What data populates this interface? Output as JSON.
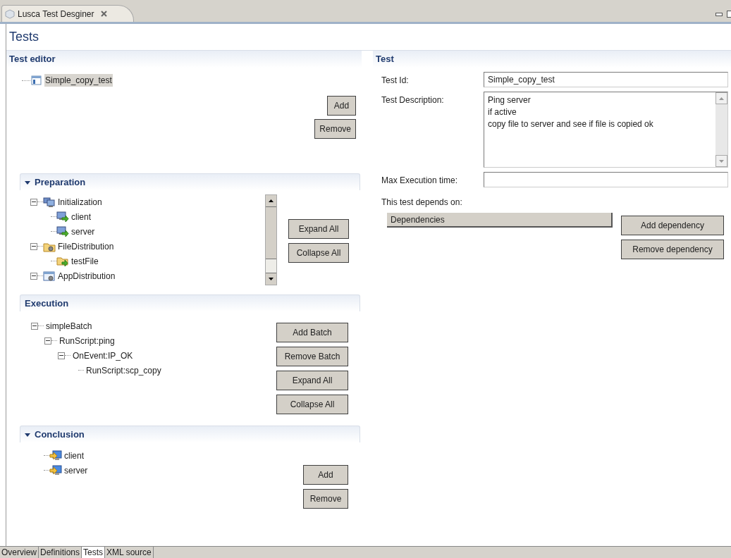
{
  "editor_tab": {
    "title": "Lusca Test Desginer"
  },
  "page_title": "Tests",
  "test_editor": {
    "title": "Test editor",
    "tests": [
      {
        "label": "Simple_copy_test",
        "selected": true
      }
    ],
    "buttons": [
      "Add",
      "Remove"
    ]
  },
  "preparation": {
    "title": "Preparation",
    "expanded": true,
    "items": [
      {
        "label": "Initialization",
        "kind": "host-group",
        "expanded": true,
        "children": [
          {
            "label": "client",
            "kind": "host"
          },
          {
            "label": "server",
            "kind": "host"
          }
        ]
      },
      {
        "label": "FileDistribution",
        "kind": "file-group",
        "expanded": true,
        "children": [
          {
            "label": "testFile",
            "kind": "file"
          }
        ]
      },
      {
        "label": "AppDistribution",
        "kind": "app-group",
        "expanded": true
      }
    ],
    "buttons": [
      "Expand All",
      "Collapse All"
    ]
  },
  "execution": {
    "title": "Execution",
    "items": [
      {
        "label": "simpleBatch",
        "expanded": true,
        "children": [
          {
            "label": "RunScript:ping",
            "expanded": true,
            "children": [
              {
                "label": "OnEvent:IP_OK",
                "expanded": true,
                "children": [
                  {
                    "label": "RunScript:scp_copy"
                  }
                ]
              }
            ]
          }
        ]
      }
    ],
    "buttons": [
      "Add Batch",
      "Remove Batch",
      "Expand All",
      "Collapse All"
    ]
  },
  "conclusion": {
    "title": "Conclusion",
    "expanded": true,
    "items": [
      {
        "label": "client",
        "kind": "result-host"
      },
      {
        "label": "server",
        "kind": "result-host"
      }
    ],
    "buttons": [
      "Add",
      "Remove"
    ]
  },
  "test": {
    "title": "Test",
    "fields": [
      {
        "label": "Test Id:",
        "kind": "text",
        "value": "Simple_copy_test"
      },
      {
        "label": "Test Description:",
        "kind": "textarea",
        "value": "Ping server\nif active\ncopy file to server and see if file is copied ok"
      },
      {
        "label": "Max Execution time:",
        "kind": "text"
      }
    ],
    "depends_label": "This test depends on:",
    "dependencies": {
      "header": "Dependencies"
    },
    "buttons": [
      "Add dependency",
      "Remove dependency"
    ]
  },
  "bottom_tabs": [
    {
      "label": "Overview",
      "selected": false
    },
    {
      "label": "Definitions",
      "selected": false
    },
    {
      "label": "Tests",
      "selected": true
    },
    {
      "label": "XML source",
      "selected": false
    }
  ]
}
